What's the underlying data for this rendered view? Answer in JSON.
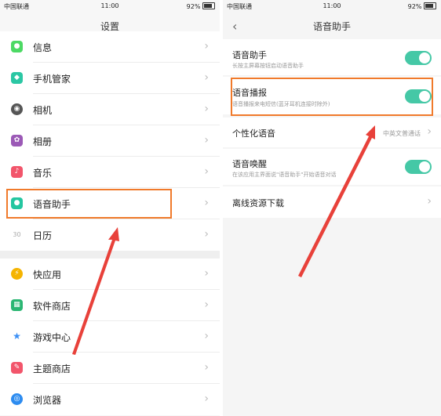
{
  "left": {
    "status": {
      "carrier": "中国联通",
      "time": "11:00",
      "battery": "92%"
    },
    "title": "设置",
    "items": [
      {
        "label": "信息",
        "icon": "message-icon",
        "color": "#4cd964"
      },
      {
        "label": "手机管家",
        "icon": "shield-icon",
        "color": "#2bc7a4"
      },
      {
        "label": "相机",
        "icon": "camera-icon",
        "color": "#555555"
      },
      {
        "label": "相册",
        "icon": "gallery-icon",
        "color": "#9b59b6"
      },
      {
        "label": "音乐",
        "icon": "music-icon",
        "color": "#f2556b"
      },
      {
        "label": "语音助手",
        "icon": "voice-assistant-icon",
        "color": "#24c6a0"
      },
      {
        "label": "日历",
        "icon": "calendar-icon",
        "color": "#cccccc"
      },
      {
        "label": "快应用",
        "icon": "quick-app-icon",
        "color": "#f5b400"
      },
      {
        "label": "软件商店",
        "icon": "app-store-icon",
        "color": "#2bb673"
      },
      {
        "label": "游戏中心",
        "icon": "game-center-icon",
        "color": "#3b8ff5"
      },
      {
        "label": "主题商店",
        "icon": "theme-store-icon",
        "color": "#f2556b"
      },
      {
        "label": "浏览器",
        "icon": "browser-icon",
        "color": "#2d8cf0"
      }
    ]
  },
  "right": {
    "status": {
      "carrier": "中国联通",
      "time": "11:00",
      "battery": "92%"
    },
    "title": "语音助手",
    "rows": [
      {
        "title": "语音助手",
        "subtitle": "长按主屏幕按钮启动语音助手",
        "toggle": true
      },
      {
        "title": "语音播报",
        "subtitle": "语音播报来电短信(蓝牙耳机连接时除外)",
        "toggle": true
      },
      {
        "title": "个性化语音",
        "value": "中英文普通话"
      },
      {
        "title": "语音唤醒",
        "subtitle": "在该应用主界面说\"语音助手\"开始语音对话",
        "toggle": true
      },
      {
        "title": "离线资源下载"
      }
    ]
  },
  "colors": {
    "accent": "#45c8a6",
    "highlight": "#f07a2b",
    "arrow": "#e8413a"
  }
}
